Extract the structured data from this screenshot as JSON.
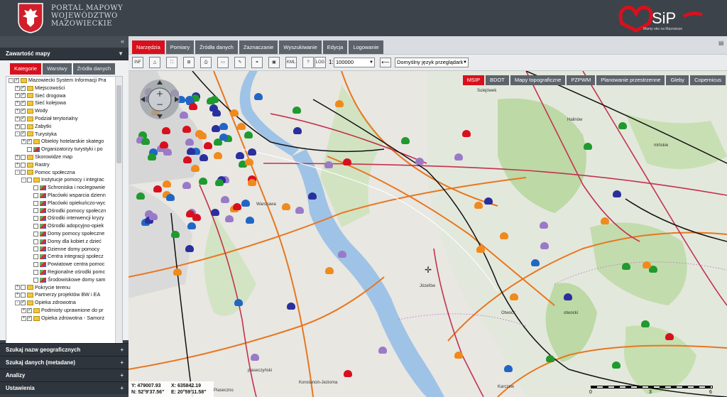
{
  "header": {
    "title_lines": [
      "PORTAL MAPOWY",
      "WOJEWÓDZTWO",
      "MAZOWIECKIE"
    ],
    "msip_text": "SiP",
    "msip_tagline": "Mamy oko na Mazowsze"
  },
  "sidebar": {
    "collapse_symbol": "«",
    "contents_header": "Zawartość mapy",
    "subtabs": [
      "Kategorie",
      "Warstwy",
      "Źródła danych"
    ],
    "tree": [
      {
        "label": "Mazowiecki System Informacji Pra",
        "level": 0,
        "checked": true,
        "kind": "folder",
        "exp": "-"
      },
      {
        "label": "Miejscowości",
        "level": 1,
        "checked": true,
        "kind": "folder",
        "exp": "+"
      },
      {
        "label": "Sieć drogowa",
        "level": 1,
        "checked": true,
        "kind": "folder",
        "exp": "+"
      },
      {
        "label": "Sieć kolejowa",
        "level": 1,
        "checked": true,
        "kind": "folder",
        "exp": "+"
      },
      {
        "label": "Wody",
        "level": 1,
        "checked": true,
        "kind": "folder",
        "exp": "+"
      },
      {
        "label": "Podział terytorialny",
        "level": 1,
        "checked": true,
        "kind": "folder",
        "exp": "+"
      },
      {
        "label": "Zabytki",
        "level": 1,
        "checked": false,
        "kind": "folder",
        "exp": "+"
      },
      {
        "label": "Turystyka",
        "level": 1,
        "checked": true,
        "kind": "folder",
        "exp": "-"
      },
      {
        "label": "Obiekty hotelarskie skatego",
        "level": 2,
        "checked": true,
        "kind": "folder",
        "exp": "+"
      },
      {
        "label": "Organizatorzy turystyki i po",
        "level": 2,
        "checked": false,
        "kind": "legend",
        "exp": ""
      },
      {
        "label": "Skorowidze map",
        "level": 1,
        "checked": false,
        "kind": "folder",
        "exp": "+"
      },
      {
        "label": "Rastry",
        "level": 1,
        "checked": false,
        "kind": "folder",
        "exp": "+"
      },
      {
        "label": "Pomoc społeczna",
        "level": 1,
        "checked": false,
        "kind": "folder",
        "exp": "-"
      },
      {
        "label": "Instytucje pomocy i integrac",
        "level": 2,
        "checked": false,
        "kind": "folder",
        "exp": "-"
      },
      {
        "label": "Schroniska i noclegownie",
        "level": 3,
        "checked": false,
        "kind": "legend",
        "exp": ""
      },
      {
        "label": "Placówki wsparcia dzienn",
        "level": 3,
        "checked": false,
        "kind": "legend",
        "exp": ""
      },
      {
        "label": "Placówki opiekuńczo-wyc",
        "level": 3,
        "checked": false,
        "kind": "legend",
        "exp": ""
      },
      {
        "label": "Ośrodki pomocy społeczn",
        "level": 3,
        "checked": false,
        "kind": "legend",
        "exp": ""
      },
      {
        "label": "Ośrodki interwencji kryzy",
        "level": 3,
        "checked": false,
        "kind": "legend",
        "exp": ""
      },
      {
        "label": "Ośrodki adopcyjno-opiek",
        "level": 3,
        "checked": false,
        "kind": "legend",
        "exp": ""
      },
      {
        "label": "Domy pomocy społeczne",
        "level": 3,
        "checked": false,
        "kind": "legend",
        "exp": ""
      },
      {
        "label": "Domy dla kobiet z dzieć",
        "level": 3,
        "checked": false,
        "kind": "legend",
        "exp": ""
      },
      {
        "label": "Dzienne domy pomocy",
        "level": 3,
        "checked": false,
        "kind": "legend",
        "exp": ""
      },
      {
        "label": "Centra integracji społecz",
        "level": 3,
        "checked": false,
        "kind": "legend",
        "exp": ""
      },
      {
        "label": "Powiatowe centra pomoc",
        "level": 3,
        "checked": false,
        "kind": "legend",
        "exp": ""
      },
      {
        "label": "Regionalne ośrodki pomc",
        "level": 3,
        "checked": false,
        "kind": "legend",
        "exp": ""
      },
      {
        "label": "Środowiskowe domy sam",
        "level": 3,
        "checked": false,
        "kind": "legend",
        "exp": ""
      },
      {
        "label": "Pokrycie terenu",
        "level": 1,
        "checked": false,
        "kind": "folder",
        "exp": "+"
      },
      {
        "label": "Partnerzy projektów BW i EA",
        "level": 1,
        "checked": false,
        "kind": "folder",
        "exp": "+"
      },
      {
        "label": "Opieka zdrowotna",
        "level": 1,
        "checked": true,
        "kind": "folder",
        "exp": "-"
      },
      {
        "label": "Podmioty uprawnione do pr",
        "level": 2,
        "checked": true,
        "kind": "folder",
        "exp": "+"
      },
      {
        "label": "Opieka zdrowotna - Samorz",
        "level": 2,
        "checked": true,
        "kind": "folder",
        "exp": "+"
      }
    ],
    "accordions": [
      "Szukaj nazw geograficznych",
      "Szukaj danych (metadane)",
      "Analizy",
      "Ustawienia"
    ]
  },
  "tabs": [
    "Narzędzia",
    "Pomiary",
    "Źródła danych",
    "Zaznaczanie",
    "Wyszukiwanie",
    "Edycja",
    "Logowanie"
  ],
  "toolbar": {
    "tools": [
      "INF",
      "measure-area",
      "zoom-extent",
      "zoom-in-box",
      "print",
      "pdf",
      "sketch",
      "link",
      "screen",
      "kml",
      "help",
      "log"
    ],
    "tool_labels": {
      "info": "INF",
      "kml": "KML",
      "help": "?",
      "log": "LOG"
    },
    "scale_prefix": "1:",
    "scale_value": "100000",
    "back_symbol": "⟵",
    "language_value": "Domyślny język przeglądarki"
  },
  "basemaps": [
    "MSIP",
    "BDOT",
    "Mapy topograficzne",
    "PZPWM",
    "Planowanie przestrzenne",
    "Gleby",
    "Copernicus"
  ],
  "map_labels": [
    "Sulejówek",
    "Halinów",
    "mińskie",
    "Warszawa",
    "Józefów",
    "Otwock",
    "otwocki",
    "piaseczyński",
    "Konstancin-Jeziorna",
    "Piaseczno",
    "Karczew"
  ],
  "coords": {
    "y": "Y: 479007.93",
    "x": "X: 635842.19",
    "n": "N: 52°9'37.56\"",
    "e": "E: 20°59'11.58\""
  },
  "scalebar": {
    "ticks": [
      "0",
      "3",
      "6"
    ]
  },
  "colors": {
    "accent": "#d8101d",
    "tab_bg": "#5c636b",
    "header_bg": "#3c434b",
    "river": "#9fc3e6",
    "forest": "#b9d7a3"
  }
}
